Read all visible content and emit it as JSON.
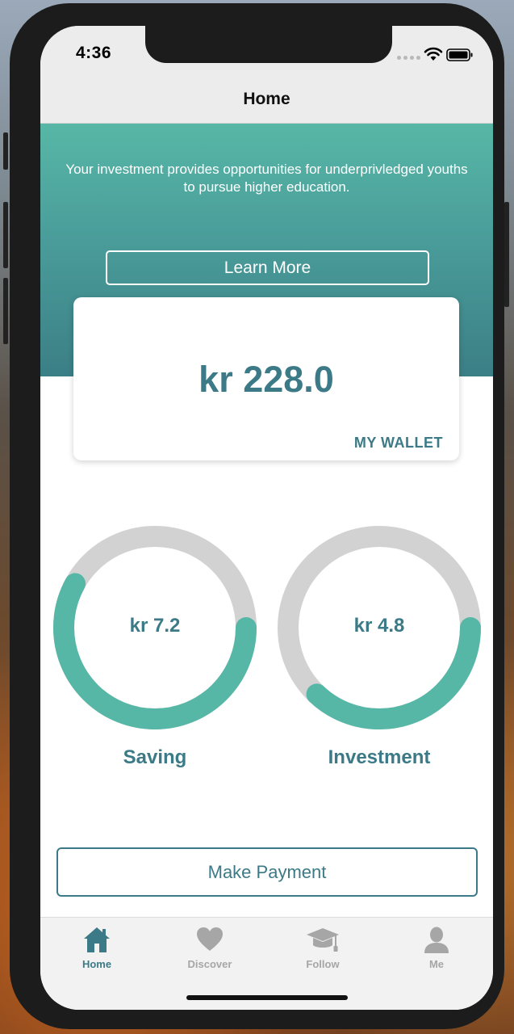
{
  "status_bar": {
    "time": "4:36"
  },
  "nav": {
    "title": "Home"
  },
  "hero": {
    "description": "Your investment provides opportunities for underprivledged youths to pursue higher education.",
    "learn_more_label": "Learn More"
  },
  "wallet": {
    "amount": "kr 228.0",
    "label": "MY WALLET"
  },
  "gauges": [
    {
      "value": "kr 7.2",
      "label": "Saving",
      "fill_fraction": 0.58
    },
    {
      "value": "kr 4.8",
      "label": "Investment",
      "fill_fraction": 0.37
    }
  ],
  "actions": {
    "make_payment_label": "Make Payment"
  },
  "tabs": [
    {
      "label": "Home",
      "icon": "home-icon",
      "active": true
    },
    {
      "label": "Discover",
      "icon": "heart-icon",
      "active": false
    },
    {
      "label": "Follow",
      "icon": "graduation-cap-icon",
      "active": false
    },
    {
      "label": "Me",
      "icon": "person-icon",
      "active": false
    }
  ],
  "colors": {
    "accent": "#3b7a86",
    "teal": "#57b7a6",
    "track": "#d2d2d2",
    "inactive": "#a6a6a6"
  }
}
